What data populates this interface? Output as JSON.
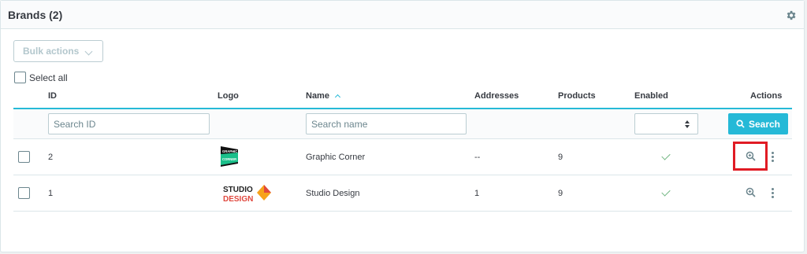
{
  "header": {
    "title": "Brands (2)",
    "settings_icon": "gear-icon"
  },
  "bulk_actions": {
    "label": "Bulk actions"
  },
  "select_all": {
    "label": "Select all"
  },
  "columns": {
    "id": "ID",
    "logo": "Logo",
    "name": "Name",
    "addresses": "Addresses",
    "products": "Products",
    "enabled": "Enabled",
    "actions": "Actions"
  },
  "filters": {
    "id_placeholder": "Search ID",
    "name_placeholder": "Search name",
    "search_label": "Search"
  },
  "rows": [
    {
      "id": "2",
      "name": "Graphic Corner",
      "addresses": "--",
      "products": "9",
      "enabled": true,
      "logo_text_1": "GRAPHIC",
      "logo_text_2": "CORNER"
    },
    {
      "id": "1",
      "name": "Studio Design",
      "addresses": "1",
      "products": "9",
      "enabled": true,
      "logo_text_1": "STUDIO",
      "logo_text_2": "DESIGN"
    }
  ],
  "colors": {
    "accent": "#25b9d7",
    "enabled": "#70b580",
    "highlight": "#e01b24"
  }
}
